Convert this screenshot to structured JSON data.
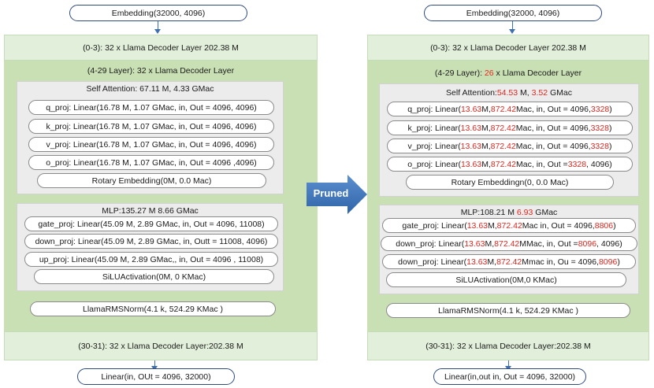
{
  "left": {
    "embedding": "Embedding(32000,  4096)",
    "band_top": "(0-3): 32 x Llama Decoder Layer 202.38 M",
    "mid_title": "(4-29 Layer): 32 x Llama Decoder Layer",
    "attn_title": "Self Attention: 67.11 M,  4.33 GMac",
    "q_proj": "q_proj: Linear(16.78 M,  1.07 GMac,  in, Out = 4096,  4096)",
    "k_proj": "k_proj: Linear(16.78 M, 1.07 GMac,   in, Out =  4096,  4096)",
    "v_proj": "v_proj: Linear(16.78 M, 1.07 GMac,  in, Out =  4096,  4096)",
    "o_proj": "o_proj: Linear(16.78 M, 1.07 GMac, in, Out =  4096  ,4096)",
    "rotary": "Rotary Embedding(0M,  0.0 Mac)",
    "mlp_title": "MLP:135.27 M 8.66 GMac",
    "gate_proj": "gate_proj: Linear(45.09 M, 2.89 GMac,   in, Out = 4096, 11008)",
    "down_proj": "down_proj: Linear(45.09 M, 2.89 GMac,  in, Outt = 11008, 4096)",
    "up_proj": "up_proj: Linear(45.09 M,  2.89 GMac,, in, Out = 4096 ,  11008)",
    "silu": "SiLUActivation(0M,  0 KMac)",
    "norm": "LlamaRMSNorm(4.1 k,  524.29 KMac  )",
    "band_bottom": "(30-31): 32 x Llama Decoder Layer:202.38 M",
    "linear": "Linear(in, OUt = 4096,  32000)"
  },
  "arrow_label": "Pruned",
  "right": {
    "embedding": "Embedding(32000,  4096)",
    "band_top": "(0-3): 32 x Llama Decoder Layer 202.38 M",
    "mid_title": {
      "a": "(4-29 Layer): ",
      "b": "26",
      "c": " x Llama Decoder Layer"
    },
    "attn_title": {
      "a": "Self Attention:",
      "b": "54.53",
      "c": " M, ",
      "d": "3.52",
      "e": " GMac"
    },
    "q_proj": {
      "a": "q_proj: Linear(",
      "b": "13.63",
      "c": " M, ",
      "d": "872.42",
      "e": "Mac,   in, Out = 4096, ",
      "f": "3328",
      "g": ")"
    },
    "k_proj": {
      "a": "k_proj: Linear(",
      "b": "13.63",
      "c": " M, ",
      "d": "872.42",
      "e": "Mac,      in, Out = 4096, ",
      "f": "3328",
      "g": ")"
    },
    "v_proj": {
      "a": "v_proj: Linear(",
      "b": "13.63",
      "c": " M,  ",
      "d": "872.42",
      "e": "Mac,  in, Out =  4096, ",
      "f": "3328",
      "g": ")"
    },
    "o_proj": {
      "a": "o_proj: Linear(",
      "b": "13.63",
      "c": " M,  ",
      "d": "872.42",
      "e": "Mac,  in, Out = ",
      "f": "3328",
      "g": ",    4096)"
    },
    "rotary": "Rotary Embeddingn(0,  0.0 Mac)",
    "mlp_title": {
      "a": "MLP:108.21 M ",
      "b": "6.93",
      "c": " GMac"
    },
    "gate_proj": {
      "a": "gate_proj: Linear(",
      "b": "13.63",
      "c": " M,   ",
      "d": "872.42",
      "e": " Mac  in, Out = 4096,  ",
      "f": "8806",
      "g": ")"
    },
    "down_proj": {
      "a": "down_proj: Linear(",
      "b": "13.63",
      "c": " M, ",
      "d": "872.42",
      "e": " MMac,   in, Out = ",
      "f": "8096",
      "g": ", 4096)"
    },
    "down_proj2": {
      "a": "down_proj: Linear(",
      "b": "13.63",
      "c": " M,  ",
      "d": "872.42",
      "e": " Mmac  in, Ou = 4096, ",
      "f": "8096",
      "g": ")"
    },
    "silu": "SiLUActivation(0M,0 KMac)",
    "norm": "LlamaRMSNorm(4.1 k,  524.29 KMac )",
    "band_bottom": "(30-31): 32 x Llama Decoder Layer:202.38 M",
    "linear": "Linear(in,out  in, Out = 4096,  32000)"
  },
  "colors": {
    "highlight": "#e0261f",
    "arrow": "#4a7fc1",
    "band": "#e2efda",
    "mid": "#c9e0b4",
    "sub": "#ececec"
  }
}
